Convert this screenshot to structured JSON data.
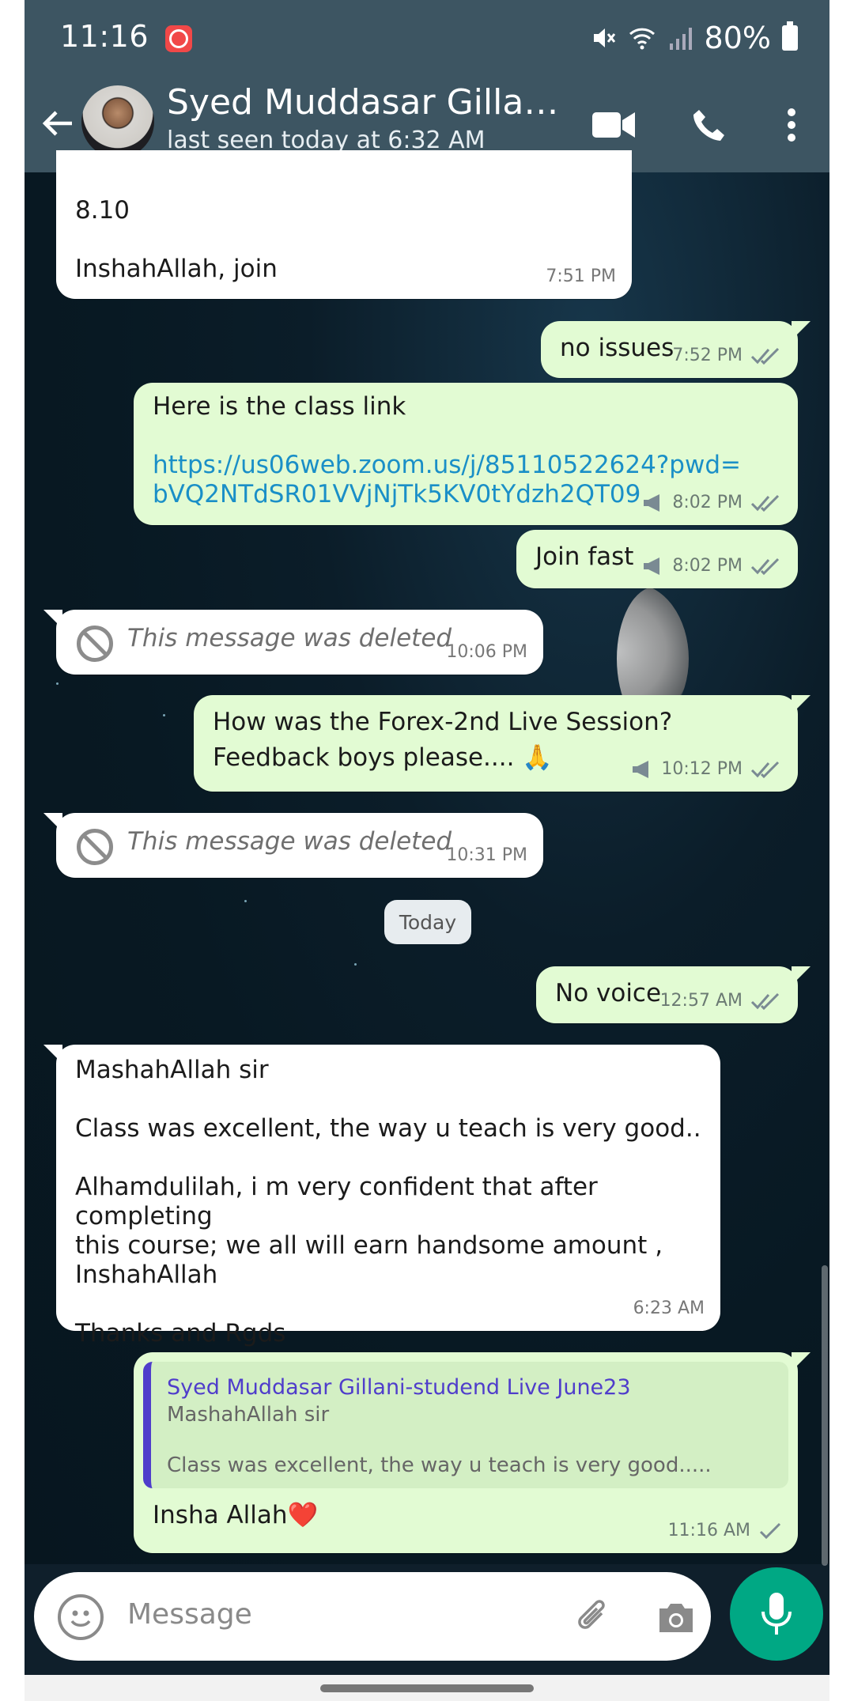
{
  "status_bar": {
    "time": "11:16",
    "battery": "80%"
  },
  "header": {
    "contact_name": "Syed Muddasar Gillani-...",
    "contact_status": "last seen today at 6:32 AM"
  },
  "messages": [
    {
      "type": "in",
      "lines": [
        "8.10",
        "",
        "InshahAllah, join"
      ],
      "time": "7:51 PM"
    },
    {
      "type": "out",
      "text": "no issues",
      "time": "7:52 PM"
    },
    {
      "type": "out",
      "text": "Here is the class link",
      "link": "https://us06web.zoom.us/j/85110522624?pwd=bVQ2NTdSR01VVjNjTk5KV0tYdzh2QT09",
      "link_line1": "https://us06web.zoom.us/j/85110522624?pwd=",
      "link_line2": "bVQ2NTdSR01VVjNjTk5KV0tYdzh2QT09",
      "time": "8:02 PM"
    },
    {
      "type": "out",
      "text": "Join fast",
      "time": "8:02 PM"
    },
    {
      "type": "deleted",
      "text": "This message was deleted",
      "time": "10:06 PM"
    },
    {
      "type": "out",
      "line1": "How was the Forex-2nd Live Session?",
      "line2": "Feedback boys please.... 🙏",
      "time": "10:12 PM"
    },
    {
      "type": "deleted",
      "text": "This message was deleted",
      "time": "10:31 PM"
    },
    {
      "type": "out",
      "text": "No voice",
      "time": "12:57 AM"
    },
    {
      "type": "in",
      "line1": "MashahAllah sir",
      "line2": "Class was excellent, the way u teach is very good..",
      "line3": "Alhamdulilah, i m very confident that after completing",
      "line4": "this course; we all will earn handsome amount ,",
      "line5": "InshahAllah",
      "line6": "Thanks and Rgds",
      "time": "6:23 AM"
    },
    {
      "type": "reply",
      "quote_name": "Syed Muddasar Gillani-studend Live June23",
      "quote_line1": "MashahAllah sir",
      "quote_line2": "Class was excellent, the way u teach is very good.....",
      "text": "Insha Allah❤️",
      "time": "11:16 AM"
    }
  ],
  "date_divider": "Today",
  "composer": {
    "placeholder": "Message"
  },
  "colors": {
    "header": "#3d5562",
    "outgoing": "#e2fbd3",
    "incoming": "#ffffff",
    "link": "#1a8fc7",
    "mic": "#00a884",
    "quote_accent": "#4f3dcb"
  }
}
